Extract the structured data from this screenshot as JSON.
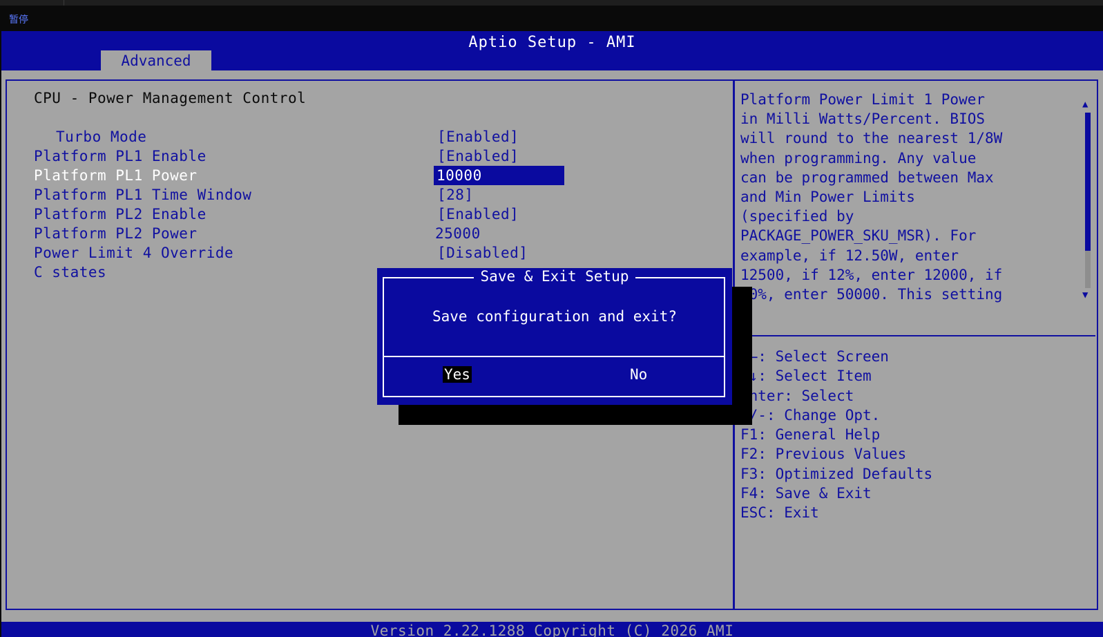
{
  "viewer": {
    "pause_label": "暂停"
  },
  "app": {
    "title": "Aptio Setup - AMI",
    "active_tab": "Advanced"
  },
  "page": {
    "heading": "CPU - Power Management Control",
    "settings": [
      {
        "label": "Turbo Mode",
        "value": "[Enabled]",
        "indented": true,
        "selected": false
      },
      {
        "label": "Platform PL1 Enable",
        "value": "[Enabled]",
        "indented": false,
        "selected": false
      },
      {
        "label": "Platform PL1 Power",
        "value": "10000",
        "indented": false,
        "selected": true
      },
      {
        "label": "Platform PL1 Time Window",
        "value": "[28]",
        "indented": false,
        "selected": false
      },
      {
        "label": "Platform PL2 Enable",
        "value": "[Enabled]",
        "indented": false,
        "selected": false
      },
      {
        "label": "Platform PL2 Power",
        "value": "25000",
        "indented": false,
        "selected": false
      },
      {
        "label": "Power Limit 4 Override",
        "value": "[Disabled]",
        "indented": false,
        "selected": false
      },
      {
        "label": "C states",
        "value": "",
        "indented": false,
        "selected": false
      }
    ]
  },
  "help": {
    "lines": [
      "Platform Power Limit 1 Power",
      "in Milli Watts/Percent. BIOS",
      "will round to the nearest 1/8W",
      "when programming. Any value",
      "can be programmed between Max",
      "and Min Power Limits",
      "(specified by",
      "PACKAGE_POWER_SKU_MSR). For",
      "example, if 12.50W, enter",
      "12500, if 12%, enter 12000, if",
      "50%, enter 50000. This setting"
    ],
    "keys": [
      "→←: Select Screen",
      "↑↓: Select Item",
      "Enter: Select",
      "+/-: Change Opt.",
      "F1: General Help",
      "F2: Previous Values",
      "F3: Optimized Defaults",
      "F4: Save & Exit",
      "ESC: Exit"
    ],
    "scroll_up_icon": "triangle-up",
    "scroll_down_icon": "triangle-down"
  },
  "dialog": {
    "title": "Save & Exit Setup",
    "message": "Save configuration and exit?",
    "yes_label": "Yes",
    "no_label": "No"
  },
  "footer": {
    "version": "Version 2.22.1288 Copyright (C) 2026 AMI"
  },
  "colors": {
    "bios_blue": "#0a0a9f",
    "bios_gray": "#a4a4a4",
    "selected_text": "#ffffff"
  }
}
